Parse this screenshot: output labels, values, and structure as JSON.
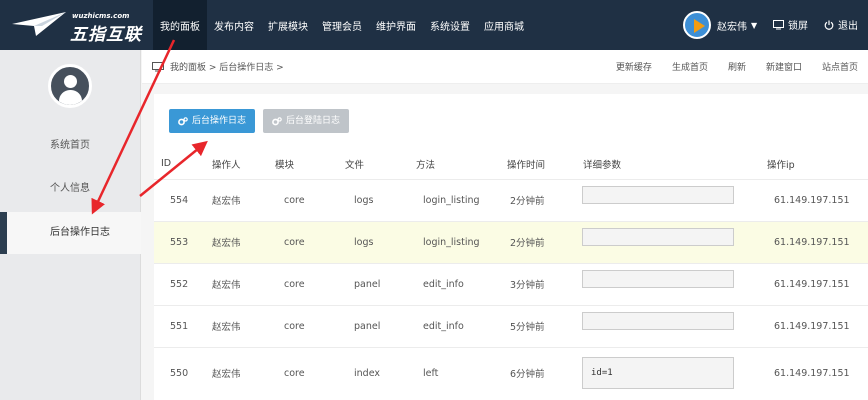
{
  "logo": {
    "small": "wuzhicms.com",
    "big": "五指互联"
  },
  "nav": [
    {
      "label": "我的面板",
      "active": true
    },
    {
      "label": "发布内容"
    },
    {
      "label": "扩展模块"
    },
    {
      "label": "管理会员"
    },
    {
      "label": "维护界面"
    },
    {
      "label": "系统设置"
    },
    {
      "label": "应用商城"
    }
  ],
  "user": {
    "name": "赵宏伟",
    "lock_label": "锁屏",
    "logout_label": "退出"
  },
  "sidebar": {
    "items": [
      "系统首页",
      "个人信息",
      "后台操作日志"
    ]
  },
  "breadcrumb": "我的面板 > 后台操作日志 >",
  "toolbar_links": [
    "更新缓存",
    "生成首页",
    "刷新",
    "新建窗口",
    "站点首页"
  ],
  "tabs": {
    "operation_log": "后台操作日志",
    "login_log": "后台登陆日志"
  },
  "table": {
    "headers": [
      "ID",
      "操作人",
      "模块",
      "文件",
      "方法",
      "操作时间",
      "详细参数",
      "操作ip"
    ],
    "rows": [
      {
        "id": "554",
        "operator": "赵宏伟",
        "module": "core",
        "file": "logs",
        "method": "login_listing",
        "time": "2分钟前",
        "params": "",
        "ip": "61.149.197.151"
      },
      {
        "id": "553",
        "operator": "赵宏伟",
        "module": "core",
        "file": "logs",
        "method": "login_listing",
        "time": "2分钟前",
        "params": "",
        "ip": "61.149.197.151"
      },
      {
        "id": "552",
        "operator": "赵宏伟",
        "module": "core",
        "file": "panel",
        "method": "edit_info",
        "time": "3分钟前",
        "params": "",
        "ip": "61.149.197.151"
      },
      {
        "id": "551",
        "operator": "赵宏伟",
        "module": "core",
        "file": "panel",
        "method": "edit_info",
        "time": "5分钟前",
        "params": "",
        "ip": "61.149.197.151"
      },
      {
        "id": "550",
        "operator": "赵宏伟",
        "module": "core",
        "file": "index",
        "method": "left",
        "time": "6分钟前",
        "params": "id=1",
        "ip": "61.149.197.151"
      }
    ]
  },
  "colors": {
    "topbar": "#1f3044",
    "primary": "#3a98d6",
    "arrow": "#e8262b",
    "highlight_row": "#fbfce4"
  }
}
